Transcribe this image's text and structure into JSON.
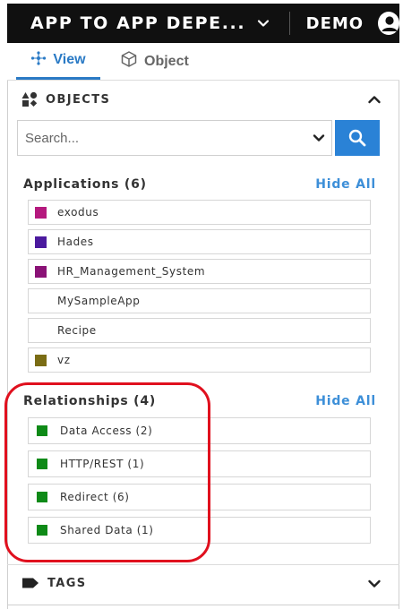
{
  "header": {
    "app_title": "APP TO APP DEPE...",
    "user_label": "DEMO"
  },
  "tabs": [
    {
      "label": "View",
      "icon": "graph-nodes-icon",
      "active": true
    },
    {
      "label": "Object",
      "icon": "cube-icon",
      "active": false
    }
  ],
  "objects_section": {
    "title": "OBJECTS",
    "icon": "shapes-icon",
    "search": {
      "placeholder": "Search..."
    }
  },
  "applications": {
    "title": "Applications (6)",
    "hide_all": "Hide All",
    "items": [
      {
        "label": "exodus",
        "color": "#b5197e"
      },
      {
        "label": "Hades",
        "color": "#4b1a9e"
      },
      {
        "label": "HR_Management_System",
        "color": "#8a1276"
      },
      {
        "label": "MySampleApp",
        "color": null
      },
      {
        "label": "Recipe",
        "color": null
      },
      {
        "label": "vz",
        "color": "#7a6c14"
      }
    ]
  },
  "relationships": {
    "title": "Relationships (4)",
    "hide_all": "Hide All",
    "items": [
      {
        "label": "Data Access (2)",
        "color": "#0e8a17"
      },
      {
        "label": "HTTP/REST (1)",
        "color": "#0e8a17"
      },
      {
        "label": "Redirect (6)",
        "color": "#0e8a17"
      },
      {
        "label": "Shared Data (1)",
        "color": "#0e8a17"
      }
    ]
  },
  "tags_section": {
    "title": "TAGS",
    "icon": "tag-icon"
  },
  "colors": {
    "accent": "#2a82d6",
    "highlight": "#e0101e"
  }
}
